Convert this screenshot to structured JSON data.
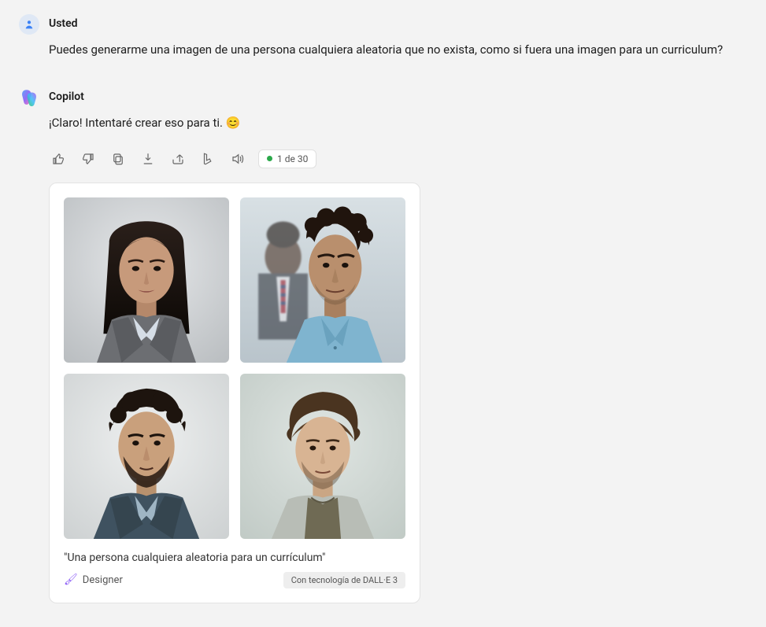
{
  "user": {
    "name": "Usted",
    "message": "Puedes generarme una imagen de una persona cualquiera aleatoria que no exista, como si fuera una imagen para un curriculum?"
  },
  "assistant": {
    "name": "Copilot",
    "message_prefix": "¡Claro! Intentaré crear eso para ti. ",
    "counter": "1 de 30",
    "card": {
      "caption": "\"Una persona cualquiera aleatoria para un currículum\"",
      "designer_label": "Designer",
      "tech_label": "Con tecnología de DALL·E 3"
    }
  }
}
